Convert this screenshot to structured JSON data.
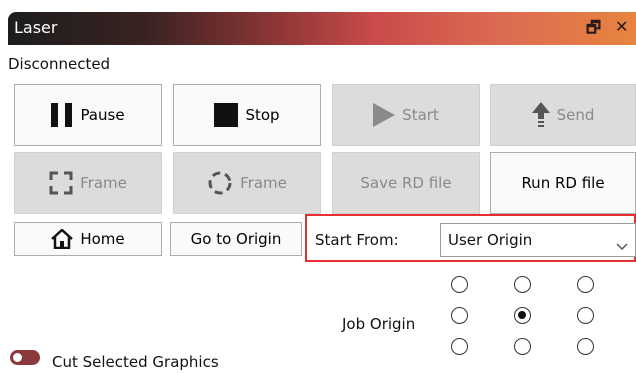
{
  "window": {
    "title": "Laser",
    "restore_icon": "restore-icon",
    "close_icon": "close-icon"
  },
  "status": "Disconnected",
  "buttons": {
    "pause": "Pause",
    "stop": "Stop",
    "start": "Start",
    "send": "Send",
    "frame1": "Frame",
    "frame2": "Frame",
    "save_rd": "Save RD file",
    "run_rd": "Run RD file",
    "home": "Home",
    "go_to_origin": "Go to Origin"
  },
  "start_from": {
    "label": "Start From:",
    "value": "User Origin"
  },
  "job_origin": {
    "label": "Job Origin",
    "selected_row": 1,
    "selected_col": 1
  },
  "cut_selected": {
    "label": "Cut Selected Graphics",
    "enabled": true
  },
  "colors": {
    "accent": "#8a3a3a",
    "highlight": "#e53030"
  }
}
